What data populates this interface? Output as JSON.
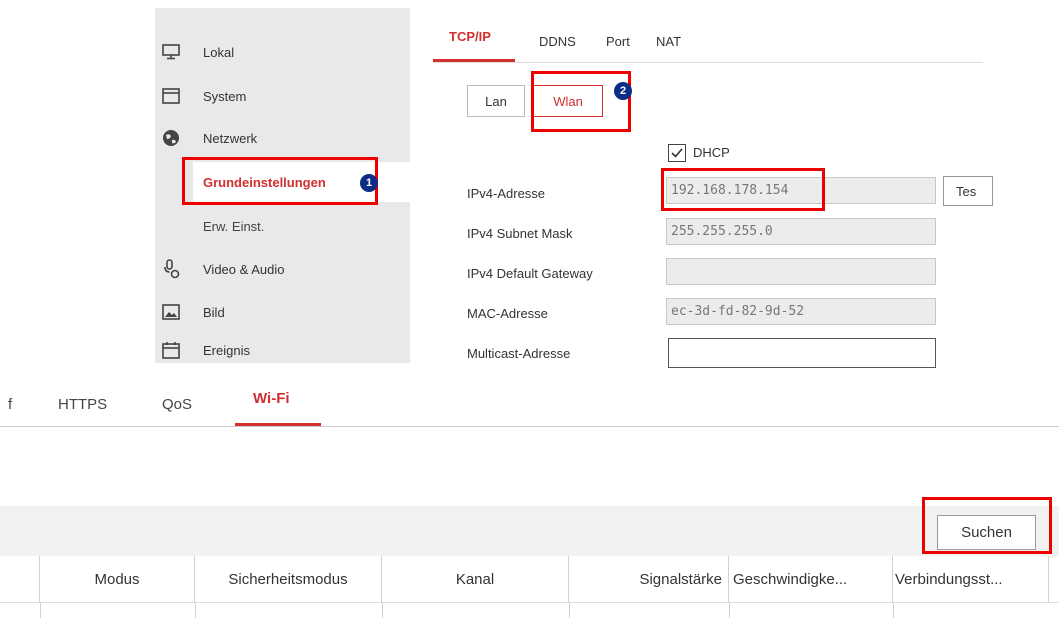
{
  "sidebar": {
    "items": [
      {
        "label": "Lokal",
        "icon": "monitor-icon"
      },
      {
        "label": "System",
        "icon": "window-icon"
      },
      {
        "label": "Netzwerk",
        "icon": "globe-icon"
      },
      {
        "label": "Video & Audio",
        "icon": "microphone-camera-icon"
      },
      {
        "label": "Bild",
        "icon": "image-icon"
      },
      {
        "label": "Ereignis",
        "icon": "calendar-icon"
      }
    ],
    "subitems": [
      {
        "label": "Grundeinstellungen"
      },
      {
        "label": "Erw. Einst."
      }
    ]
  },
  "tabs": [
    {
      "label": "TCP/IP"
    },
    {
      "label": "DDNS"
    },
    {
      "label": "Port"
    },
    {
      "label": "NAT"
    }
  ],
  "segments": [
    {
      "label": "Lan"
    },
    {
      "label": "Wlan"
    }
  ],
  "dhcp": {
    "label": "DHCP",
    "checked": true
  },
  "form": {
    "ipv4_label": "IPv4-Adresse",
    "ipv4_value": "192.168.178.154",
    "test_button": "Tes",
    "subnet_label": "IPv4 Subnet Mask",
    "subnet_value": "255.255.255.0",
    "gateway_label": "IPv4 Default Gateway",
    "gateway_value": "",
    "mac_label": "MAC-Adresse",
    "mac_value": "ec-3d-fd-82-9d-52",
    "multicast_label": "Multicast-Adresse",
    "multicast_value": ""
  },
  "badges": {
    "one": "1",
    "two": "2"
  },
  "bottom_tabs": [
    {
      "label": "f"
    },
    {
      "label": "HTTPS"
    },
    {
      "label": "QoS"
    },
    {
      "label": "Wi-Fi"
    }
  ],
  "suchen_button": "Suchen",
  "table": {
    "headers": [
      "Modus",
      "Sicherheitsmodus",
      "Kanal",
      "Signalstärke",
      "Geschwindigke...",
      "Verbindungsst..."
    ]
  },
  "colors": {
    "accent": "#d32f2f",
    "highlight": "#e00000",
    "badge": "#0d2e86"
  }
}
